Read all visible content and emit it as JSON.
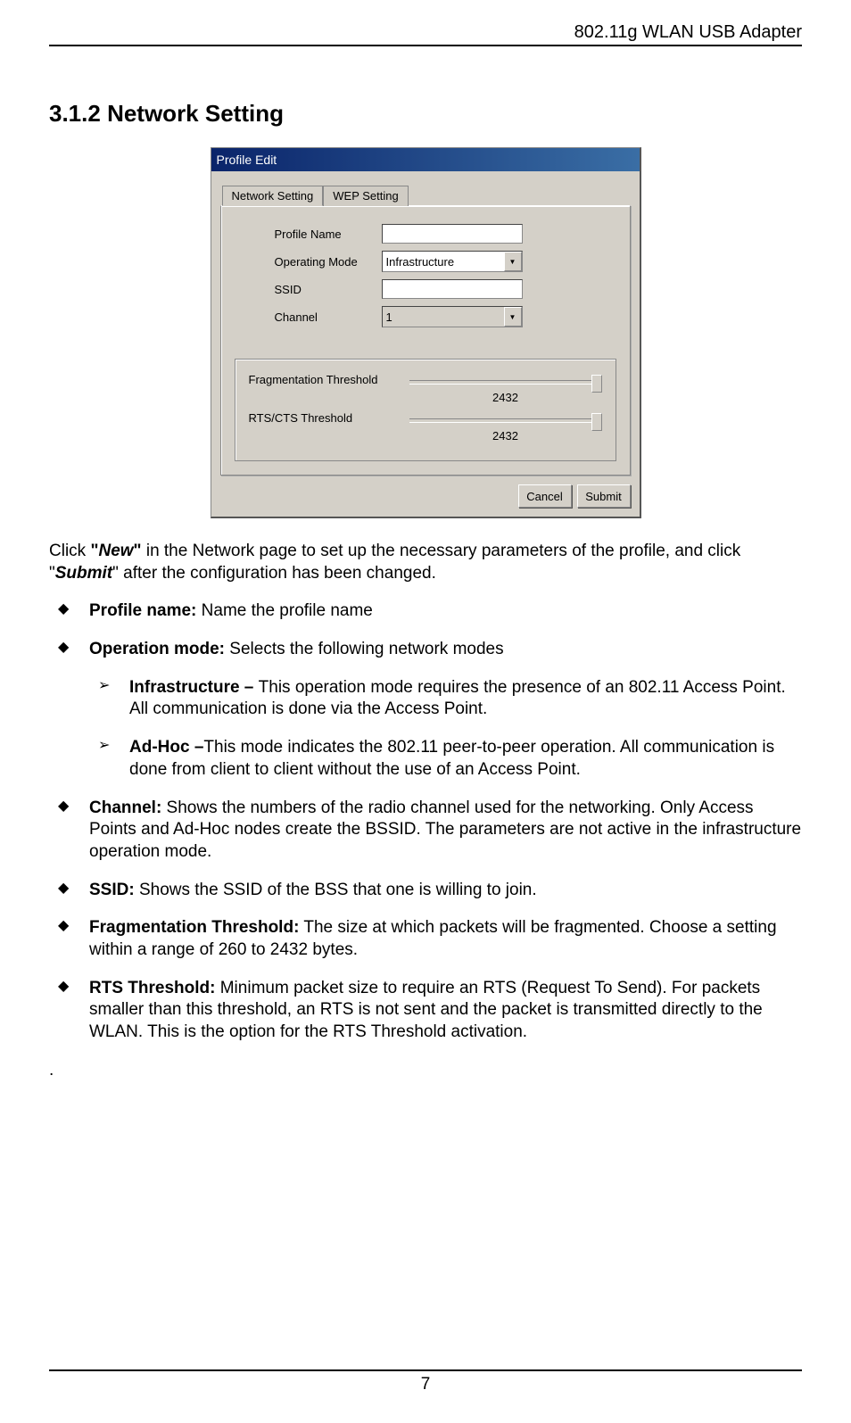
{
  "header": {
    "product": "802.11g WLAN USB Adapter"
  },
  "section": {
    "number": "3.1.2",
    "title": "Network Setting"
  },
  "dialog": {
    "title": "Profile Edit",
    "tabs": {
      "network": "Network Setting",
      "wep": "WEP Setting"
    },
    "fields": {
      "profile_name_label": "Profile Name",
      "profile_name_value": "",
      "operating_mode_label": "Operating Mode",
      "operating_mode_value": "Infrastructure",
      "ssid_label": "SSID",
      "ssid_value": "",
      "channel_label": "Channel",
      "channel_value": "1",
      "frag_label": "Fragmentation Threshold",
      "frag_value": "2432",
      "rts_label": "RTS/CTS Threshold",
      "rts_value": "2432"
    },
    "buttons": {
      "cancel": "Cancel",
      "submit": "Submit"
    }
  },
  "content": {
    "intro_pre": "Click ",
    "intro_quote1": "\"",
    "intro_new": "New",
    "intro_quote1b": "\"",
    "intro_mid": " in the Network page to set up the necessary parameters of the profile, and click \"",
    "intro_submit": "Submit",
    "intro_end": "\" after the configuration has been changed.",
    "bullets": {
      "profile_label": "Profile name:",
      "profile_text": " Name the profile name",
      "opmode_label": "Operation mode:",
      "opmode_text": " Selects the following network modes",
      "infra_label": "Infrastructure – ",
      "infra_text": "This operation mode requires the presence of an 802.11 Access Point. All communication is done via the Access Point.",
      "adhoc_label": "Ad-Hoc –",
      "adhoc_text": "This mode indicates the 802.11 peer-to-peer operation. All communication is done from client to client without the use of an Access Point.",
      "channel_label": "Channel:",
      "channel_text": " Shows the numbers of the radio channel used for the networking. Only Access Points and Ad-Hoc nodes create the BSSID. The parameters are not active in the infrastructure operation mode.",
      "ssid_label": "SSID:",
      "ssid_text": " Shows the SSID of the BSS that one is willing to join.",
      "frag_label": "Fragmentation Threshold:",
      "frag_text": " The size at which packets will be fragmented. Choose a setting within a range of 260 to 2432 bytes.",
      "rts_label": "RTS Threshold:",
      "rts_text": " Minimum packet size to require an RTS (Request To Send). For packets smaller than this threshold, an RTS is not sent and the packet is transmitted directly to the WLAN. This is the option for the RTS Threshold activation."
    },
    "dot": "."
  },
  "page_number": "7"
}
